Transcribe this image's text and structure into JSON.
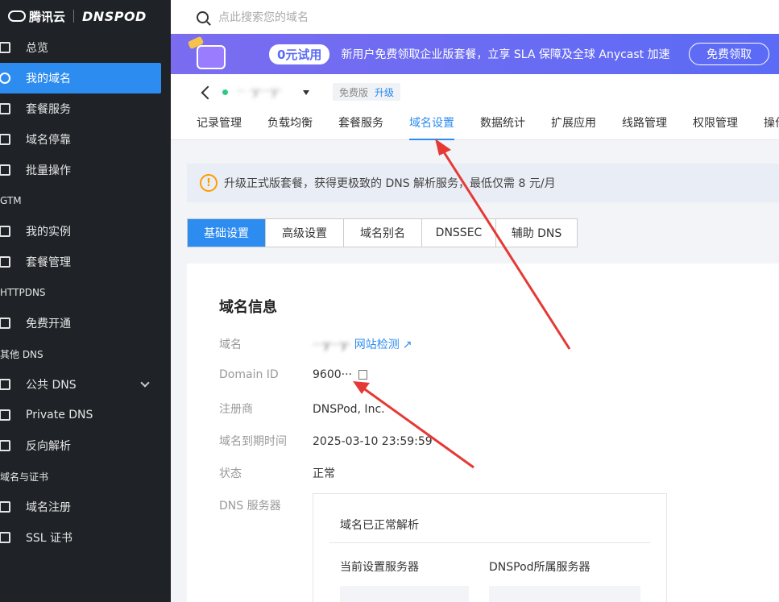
{
  "brand": {
    "tencent": "腾讯云",
    "dnspod": "DNSPOD"
  },
  "search": {
    "placeholder": "点此搜索您的域名",
    "icon": "search-icon"
  },
  "sidebar": {
    "items": [
      {
        "label": "总览",
        "icon": "overview-icon"
      },
      {
        "label": "我的域名",
        "icon": "globe-icon",
        "active": true
      },
      {
        "label": "套餐服务",
        "icon": "package-icon"
      },
      {
        "label": "域名停靠",
        "icon": "parking-icon"
      },
      {
        "label": "批量操作",
        "icon": "batch-icon"
      }
    ],
    "group_gtm": "GTM",
    "gtm_items": [
      {
        "label": "我的实例",
        "icon": "instance-icon"
      },
      {
        "label": "套餐管理",
        "icon": "package-manage-icon"
      }
    ],
    "group_httpdns": "HTTPDNS",
    "httpdns_items": [
      {
        "label": "免费开通",
        "icon": "ticket-icon"
      }
    ],
    "group_other": "其他 DNS",
    "other_items": [
      {
        "label": "公共 DNS",
        "icon": "public-dns-icon"
      },
      {
        "label": "Private DNS",
        "icon": "diamond-icon"
      },
      {
        "label": "反向解析",
        "icon": "reverse-icon"
      }
    ],
    "group_cert": "域名与证书",
    "cert_items": [
      {
        "label": "域名注册",
        "icon": "register-icon"
      },
      {
        "label": "SSL 证书",
        "icon": "ssl-icon"
      }
    ]
  },
  "promo": {
    "badge": "0元试用",
    "text": "新用户免费领取企业版套餐，立享 SLA 保障及全球 Anycast 加速",
    "cta": "免费领取"
  },
  "domain": {
    "name": "·· ·y···y·",
    "plan": "免费版",
    "upgrade": "升级"
  },
  "tabs": [
    "记录管理",
    "负载均衡",
    "套餐服务",
    "域名设置",
    "数据统计",
    "扩展应用",
    "线路管理",
    "权限管理",
    "操作"
  ],
  "notice": {
    "text": "升级正式版套餐，获得更极致的 DNS 解析服务，最低仅需 8 元/月"
  },
  "subtabs": [
    "基础设置",
    "高级设置",
    "域名别名",
    "DNSSEC",
    "辅助 DNS"
  ],
  "info": {
    "title": "域名信息",
    "domain_label": "域名",
    "domain_value": "···y···y·",
    "check_link": "网站检测",
    "id_label": "Domain ID",
    "id_value": "9600···",
    "registrar_label": "注册商",
    "registrar_value": "DNSPod, Inc.",
    "expiry_label": "域名到期时间",
    "expiry_value": "2025-03-10 23:59:59",
    "status_label": "状态",
    "status_value": "正常",
    "dns_label": "DNS 服务器",
    "dns_status": "域名已正常解析",
    "current_servers": "当前设置服务器",
    "dnspod_servers": "DNSPod所属服务器"
  },
  "colors": {
    "accent": "#2d8cf0",
    "ok": "#29cc85",
    "sidebar": "#1f2226",
    "arrow": "#e53935"
  }
}
